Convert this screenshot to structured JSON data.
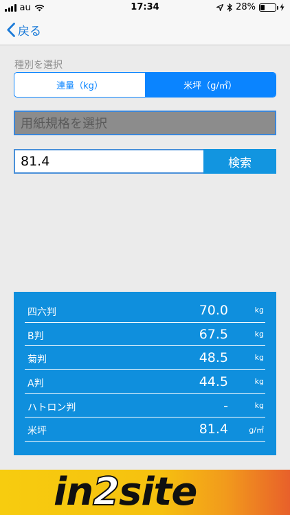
{
  "status": {
    "carrier": "au",
    "time": "17:34",
    "battery_text": "28%",
    "battery_level": 0.28
  },
  "nav": {
    "back_label": "戻る"
  },
  "category": {
    "label": "種別を選択",
    "options": [
      "連量（kg）",
      "米坪（g/㎡）"
    ],
    "selected_index": 1
  },
  "paper_select": {
    "placeholder": "用紙規格を選択"
  },
  "search": {
    "value": "81.4",
    "button_label": "検索"
  },
  "results": [
    {
      "label": "四六判",
      "value": "70.0",
      "unit": "kg"
    },
    {
      "label": "B判",
      "value": "67.5",
      "unit": "kg"
    },
    {
      "label": "菊判",
      "value": "48.5",
      "unit": "kg"
    },
    {
      "label": "A判",
      "value": "44.5",
      "unit": "kg"
    },
    {
      "label": "ハトロン判",
      "value": "-",
      "unit": "kg"
    },
    {
      "label": "米坪",
      "value": "81.4",
      "unit": "g/㎡"
    }
  ],
  "banner": {
    "logo_text": "in2site"
  },
  "colors": {
    "accent": "#0a84ff",
    "results_bg": "#0f8fdd",
    "background": "#ebebeb"
  }
}
